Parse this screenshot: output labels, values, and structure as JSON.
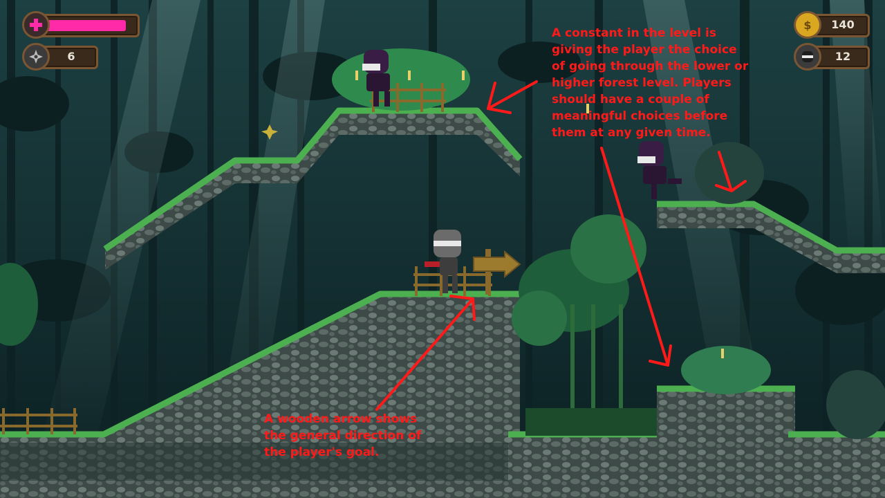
{
  "hud": {
    "health": {
      "level": 0.93,
      "color": "#ff2aa7"
    },
    "shuriken_count": "6",
    "coins": "140",
    "enemy_kills": "12"
  },
  "annotations": {
    "top_right": "A constant in the level is\ngiving the player the choice\nof going through the lower or\nhigher forest level. Players\nshould have a couple of\nmeaningful choices before\nthem at any given time.",
    "bottom": "A wooden arrow shows\nthe general direction of\nthe player's goal."
  },
  "colors": {
    "annotation": "#ff1a1a",
    "grass": "#4caf50",
    "stone": "#4a5a55",
    "background": "#0f2a2c"
  }
}
